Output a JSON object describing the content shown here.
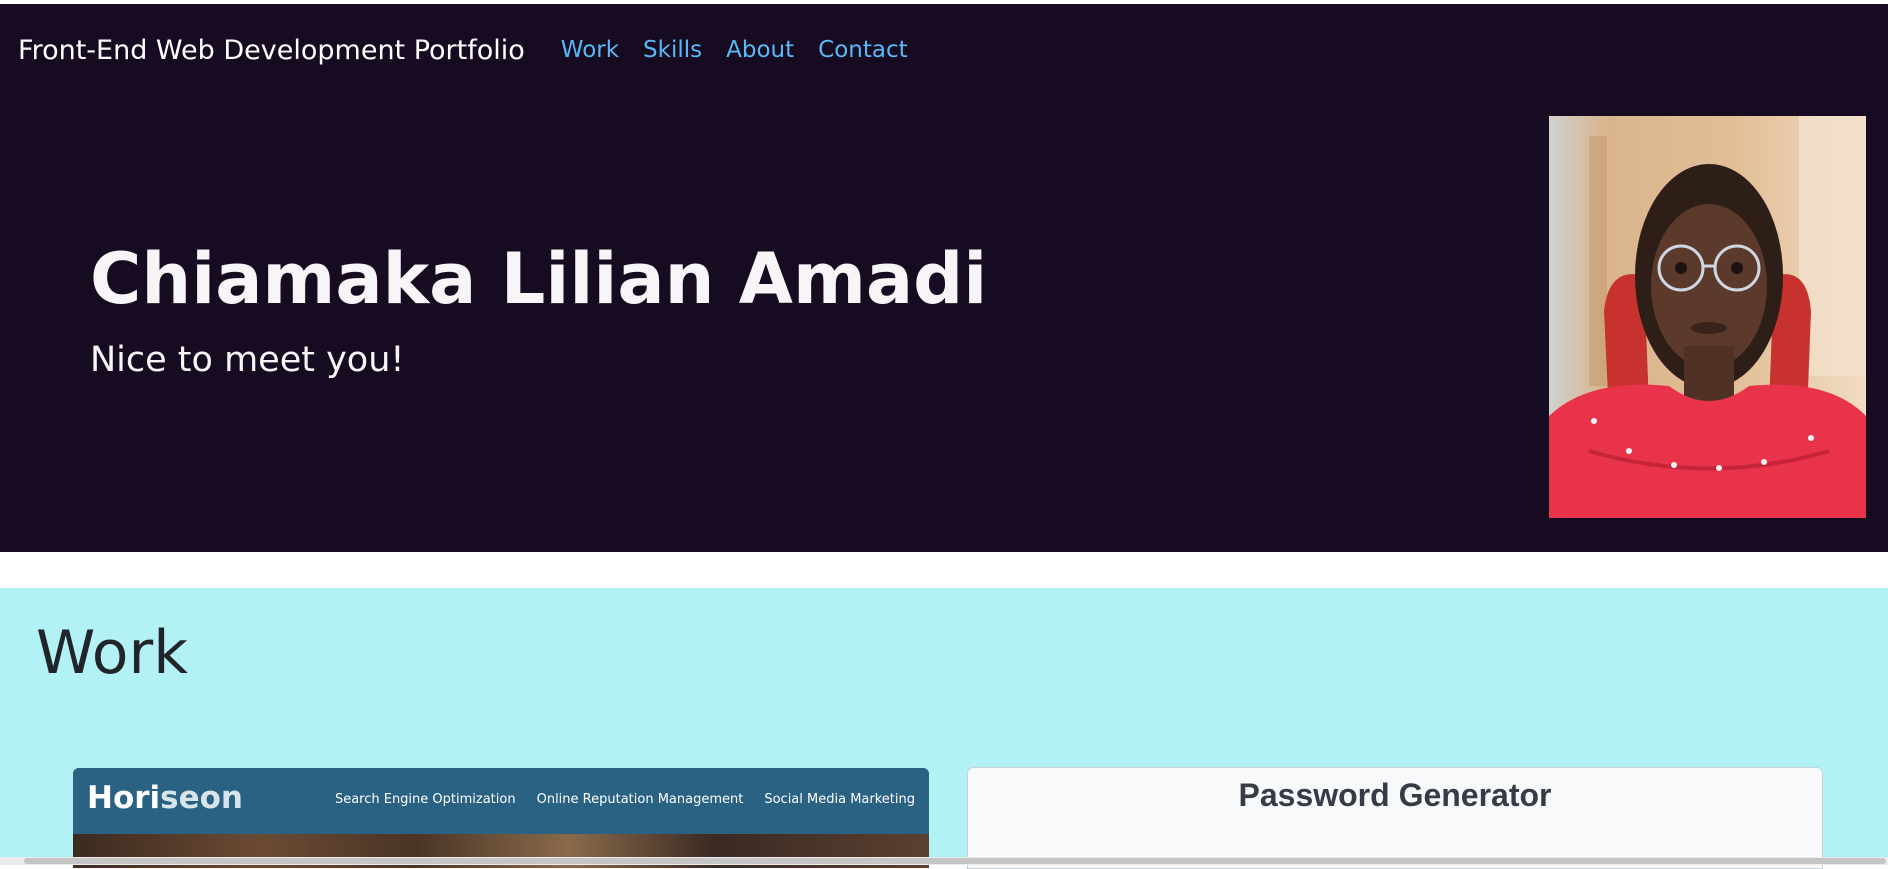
{
  "nav": {
    "brand": "Front-End Web Development Portfolio",
    "links": [
      "Work",
      "Skills",
      "About",
      "Contact"
    ]
  },
  "hero": {
    "name": "Chiamaka Lilian Amadi",
    "subtitle": "Nice to meet you!",
    "portrait_icon": "portrait-photo"
  },
  "work": {
    "title": "Work",
    "projects": [
      {
        "logo_main": "Hori",
        "logo_accent": "seon",
        "nav": [
          "Search Engine Optimization",
          "Online Reputation Management",
          "Social Media Marketing"
        ]
      },
      {
        "title": "Password Generator"
      }
    ]
  },
  "colors": {
    "hero_bg": "#170b21",
    "link": "#59b8f6",
    "work_bg": "#b2f2f5",
    "horiseon_header": "#2a6283"
  }
}
